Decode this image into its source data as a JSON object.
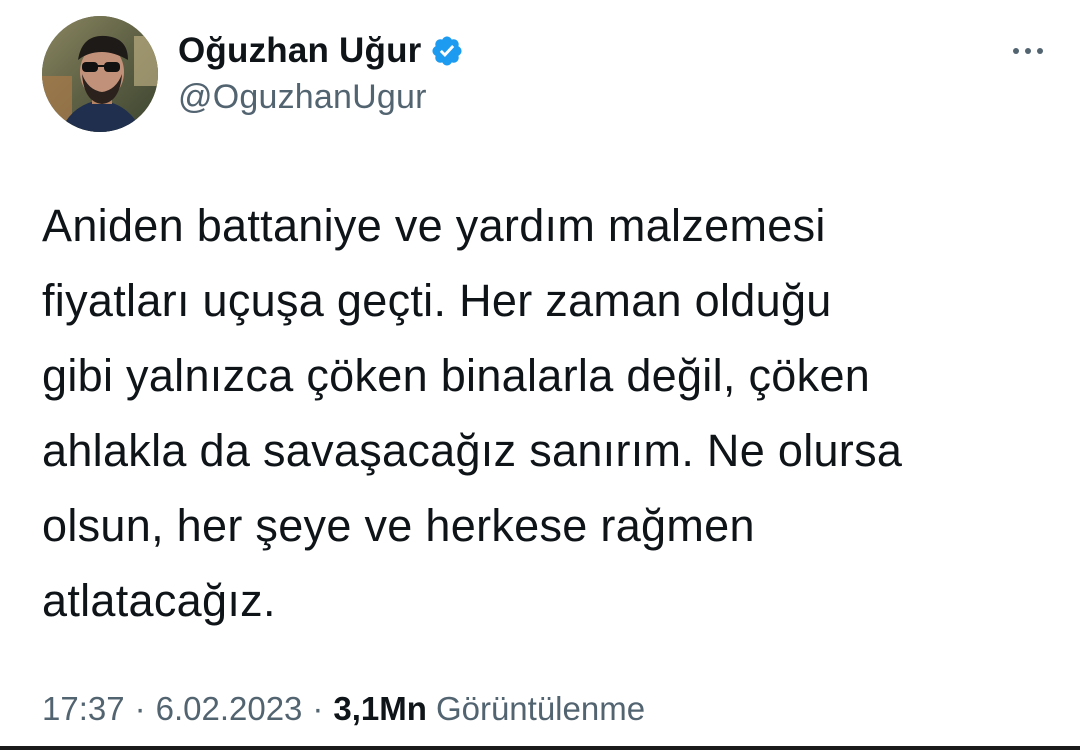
{
  "author": {
    "display_name": "Oğuzhan Uğur",
    "handle": "@OguzhanUgur",
    "verified": true,
    "accent_color": "#1d9bf0"
  },
  "tweet": {
    "text": "Aniden battaniye ve yardım malzemesi\nfiyatları uçuşa geçti. Her zaman olduğu\ngibi yalnızca çöken binalarla değil, çöken\nahlakla da savaşacağız sanırım. Ne olursa\nolsun, her şeye ve herkese rağmen\natlatacağız."
  },
  "meta": {
    "time": "17:37",
    "separator": "·",
    "date": "6.02.2023",
    "views_count": "3,1Mn",
    "views_label": "Görüntülenme"
  },
  "icons": {
    "verified": "verified-badge-icon",
    "more": "more-horizontal-icon"
  }
}
